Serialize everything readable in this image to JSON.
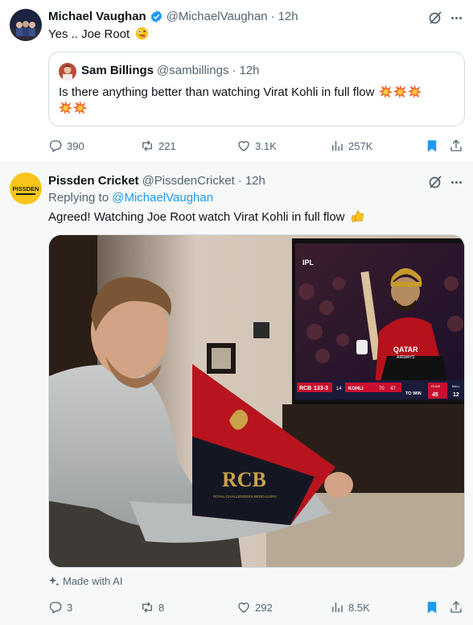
{
  "tweet1": {
    "author_name": "Michael Vaughan",
    "handle": "@MichaelVaughan",
    "separator": "·",
    "time": "12h",
    "text": "Yes .. Joe Root",
    "quote": {
      "author_name": "Sam Billings",
      "handle": "@sambillings",
      "separator": "·",
      "time": "12h",
      "text": "Is there anything better than watching Virat Kohli in full flow"
    },
    "stats": {
      "replies": "390",
      "reposts": "221",
      "likes": "3.1K",
      "views": "257K"
    }
  },
  "tweet2": {
    "author_name": "Pissden Cricket",
    "handle": "@PissdenCricket",
    "separator": "·",
    "time": "12h",
    "avatar_text": "PISSDEN",
    "replying_label": "Replying to",
    "replying_handle": "@MichaelVaughan",
    "text": "Agreed! Watching Joe Root watch Virat Kohli in full flow",
    "made_with_ai": "Made with AI",
    "image": {
      "tv_logo": "IPL",
      "scoreboard": {
        "team": "RCB",
        "score": "133-3",
        "over": "14",
        "batter": "KOHLI",
        "batter_score": "70",
        "balls": "47",
        "to_win": "TO WIN",
        "runs_label": "RUNS",
        "runs": "45",
        "balls_label": "BALL",
        "balls_left": "12"
      },
      "shirt_sponsor": "QATAR",
      "shirt_sponsor_sub": "AIRWAYS",
      "flag_text": "RCB",
      "flag_sub": "ROYAL CHALLENGERS BENGALURU"
    },
    "stats": {
      "replies": "3",
      "reposts": "8",
      "likes": "292",
      "views": "8.5K"
    }
  },
  "colors": {
    "verified": "#1d9bf0",
    "link": "#1d9bf0",
    "bookmark": "#1d9bf0",
    "muted": "#536471",
    "highlight_bg": "#f7f9f9"
  }
}
